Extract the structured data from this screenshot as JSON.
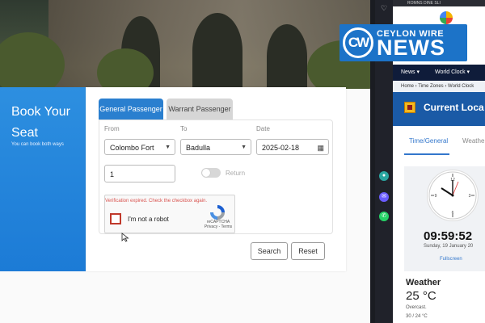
{
  "booking": {
    "title_line1": "Book Your",
    "title_line2": "Seat",
    "subtitle": "You can book both ways",
    "tabs": [
      {
        "label": "General Passenger",
        "active": true
      },
      {
        "label": "Warrant Passenger",
        "active": false
      }
    ],
    "from_label": "From",
    "from_value": "Colombo Fort",
    "to_label": "To",
    "to_value": "Badulla",
    "date_label": "Date",
    "date_value": "2025-02-18",
    "passengers_value": "1",
    "return_label": "Return",
    "return_on": false,
    "captcha": {
      "error": "Verification expired. Check the checkbox again.",
      "label": "I'm not a robot",
      "brand": "reCAPTCHA",
      "links": "Privacy - Terms"
    },
    "search_label": "Search",
    "reset_label": "Reset"
  },
  "news_site": {
    "topbar": "ROMNS   DINE   SLI",
    "logo_mark": "CW",
    "logo_top": "CEYLON WIRE",
    "logo_main": "NEWS",
    "menu": [
      "News ▾",
      "World Clock ▾"
    ],
    "breadcrumbs": "Home  ›  Time Zones  ›  World Clock",
    "page_title": "Current Loca",
    "tabs": [
      "Time/General",
      "Weathe"
    ],
    "clock_time": "09:59:52",
    "clock_date": "Sunday, 19 January 20",
    "fullscreen": "Fullscreen",
    "weather_heading": "Weather",
    "weather_temp": "25 °C",
    "weather_desc": "Overcast.",
    "weather_range": "30 / 24 °C"
  },
  "colors": {
    "accent_blue": "#2a7fcf",
    "panel_blue": "#1c7bd6",
    "error_red": "#d9534f",
    "brand_blue": "#1c73c8"
  }
}
